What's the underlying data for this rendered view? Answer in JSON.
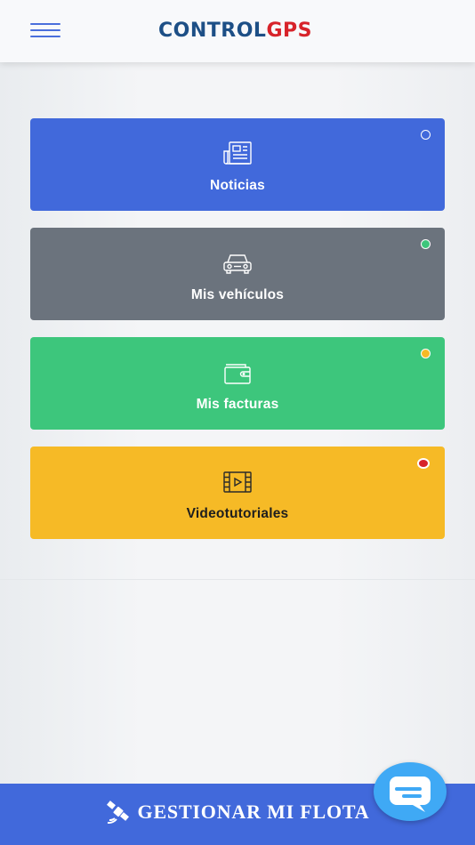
{
  "header": {
    "logo_part1": "CONTROL",
    "logo_part2": "GPS",
    "menu_icon": "hamburger-icon"
  },
  "cards": [
    {
      "label": "Noticias",
      "icon": "newspaper-icon",
      "color": "#4169db",
      "status_color": "#4169db"
    },
    {
      "label": "Mis vehículos",
      "icon": "car-icon",
      "color": "#6b737d",
      "status_color": "#3dc67c"
    },
    {
      "label": "Mis facturas",
      "icon": "wallet-icon",
      "color": "#3dc67c",
      "status_color": "#f6ba26"
    },
    {
      "label": "Videotutoriales",
      "icon": "film-icon",
      "color": "#f6ba26",
      "status_color": "#d7232a"
    }
  ],
  "footer": {
    "label": "GESTIONAR MI FLOTA",
    "icon": "satellite-icon"
  },
  "chat": {
    "icon": "chat-bubble-icon",
    "color": "#3fa9f5"
  }
}
